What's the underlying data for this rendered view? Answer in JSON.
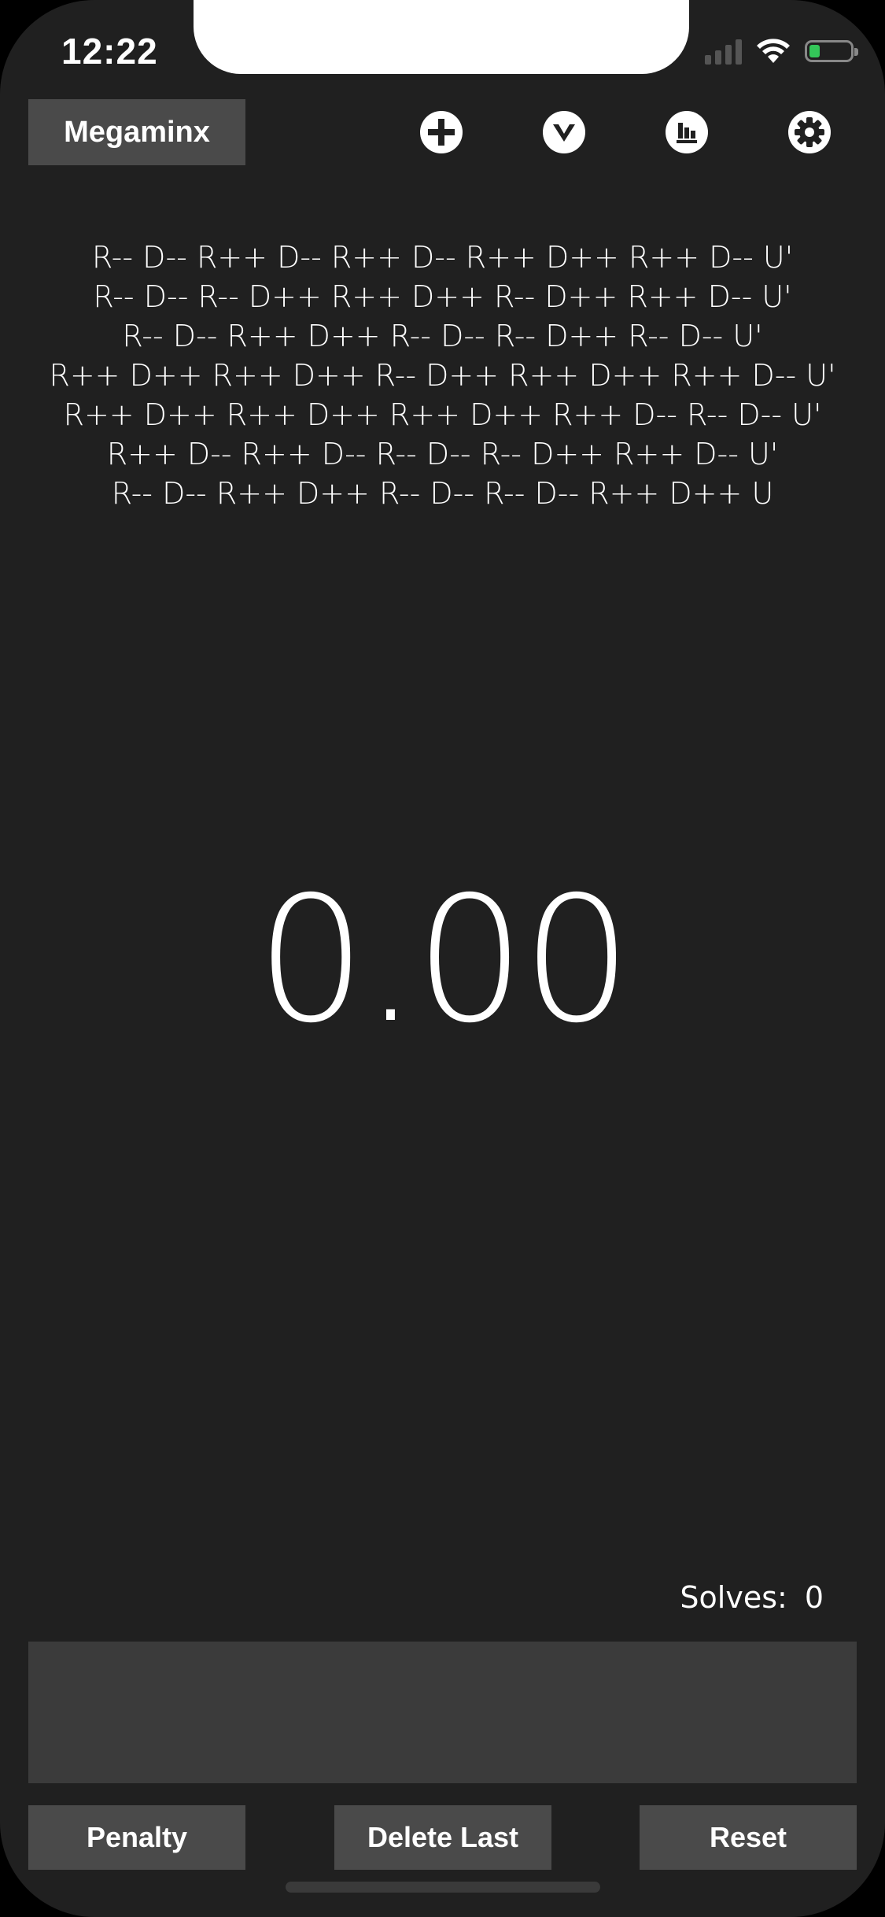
{
  "status_bar": {
    "time": "12:22",
    "battery_level": 0.25,
    "battery_color": "#34c759"
  },
  "toolbar": {
    "puzzle_label": "Megaminx",
    "icons": [
      "add-icon",
      "chevron-down-icon",
      "statistics-icon",
      "gear-icon"
    ]
  },
  "scramble": {
    "lines": [
      "R-- D-- R++ D-- R++ D-- R++ D++ R++ D-- U'",
      "R-- D-- R-- D++ R++ D++ R-- D++ R++ D-- U'",
      "R-- D-- R++ D++ R-- D-- R-- D++ R-- D-- U'",
      "R++ D++ R++ D++ R-- D++ R++ D++ R++ D-- U'",
      "R++ D++ R++ D++ R++ D++ R++ D-- R-- D-- U'",
      "R++ D-- R++ D-- R-- D-- R-- D++ R++ D-- U'",
      "R-- D-- R++ D++ R-- D-- R-- D-- R++ D++ U"
    ]
  },
  "timer": {
    "value": "0.00"
  },
  "solves": {
    "label": "Solves:",
    "count": "0"
  },
  "bottom_bar": {
    "penalty_label": "Penalty",
    "delete_last_label": "Delete Last",
    "reset_label": "Reset"
  },
  "colors": {
    "background": "#202020",
    "button": "#4a4a4a",
    "panel": "#3b3b3b",
    "text": "#ffffff"
  }
}
